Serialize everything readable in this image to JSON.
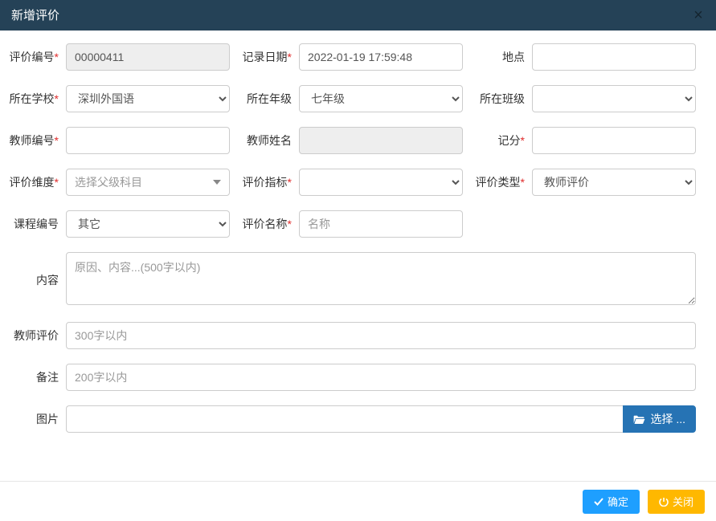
{
  "modal": {
    "title": "新增评价",
    "close": "×"
  },
  "labels": {
    "eval_no": "评价编号",
    "record_date": "记录日期",
    "location": "地点",
    "school": "所在学校",
    "grade": "所在年级",
    "class": "所在班级",
    "teacher_no": "教师编号",
    "teacher_name": "教师姓名",
    "score": "记分",
    "dimension": "评价维度",
    "indicator": "评价指标",
    "eval_type": "评价类型",
    "course_no": "课程编号",
    "eval_name": "评价名称",
    "content": "内容",
    "teacher_eval": "教师评价",
    "remark": "备注",
    "picture": "图片"
  },
  "values": {
    "eval_no": "00000411",
    "record_date": "2022-01-19 17:59:48",
    "location": "",
    "school": "深圳外国语",
    "grade": "七年级",
    "class": "",
    "teacher_no": "",
    "teacher_name": "",
    "score": "",
    "dimension_placeholder": "选择父级科目",
    "indicator": "",
    "eval_type": "教师评价",
    "course_no": "其它",
    "eval_name_placeholder": "名称",
    "content_placeholder": "原因、内容...(500字以内)",
    "teacher_eval_placeholder": "300字以内",
    "remark_placeholder": "200字以内"
  },
  "buttons": {
    "choose_file": "选择 ...",
    "confirm": "确定",
    "close": "关闭"
  }
}
